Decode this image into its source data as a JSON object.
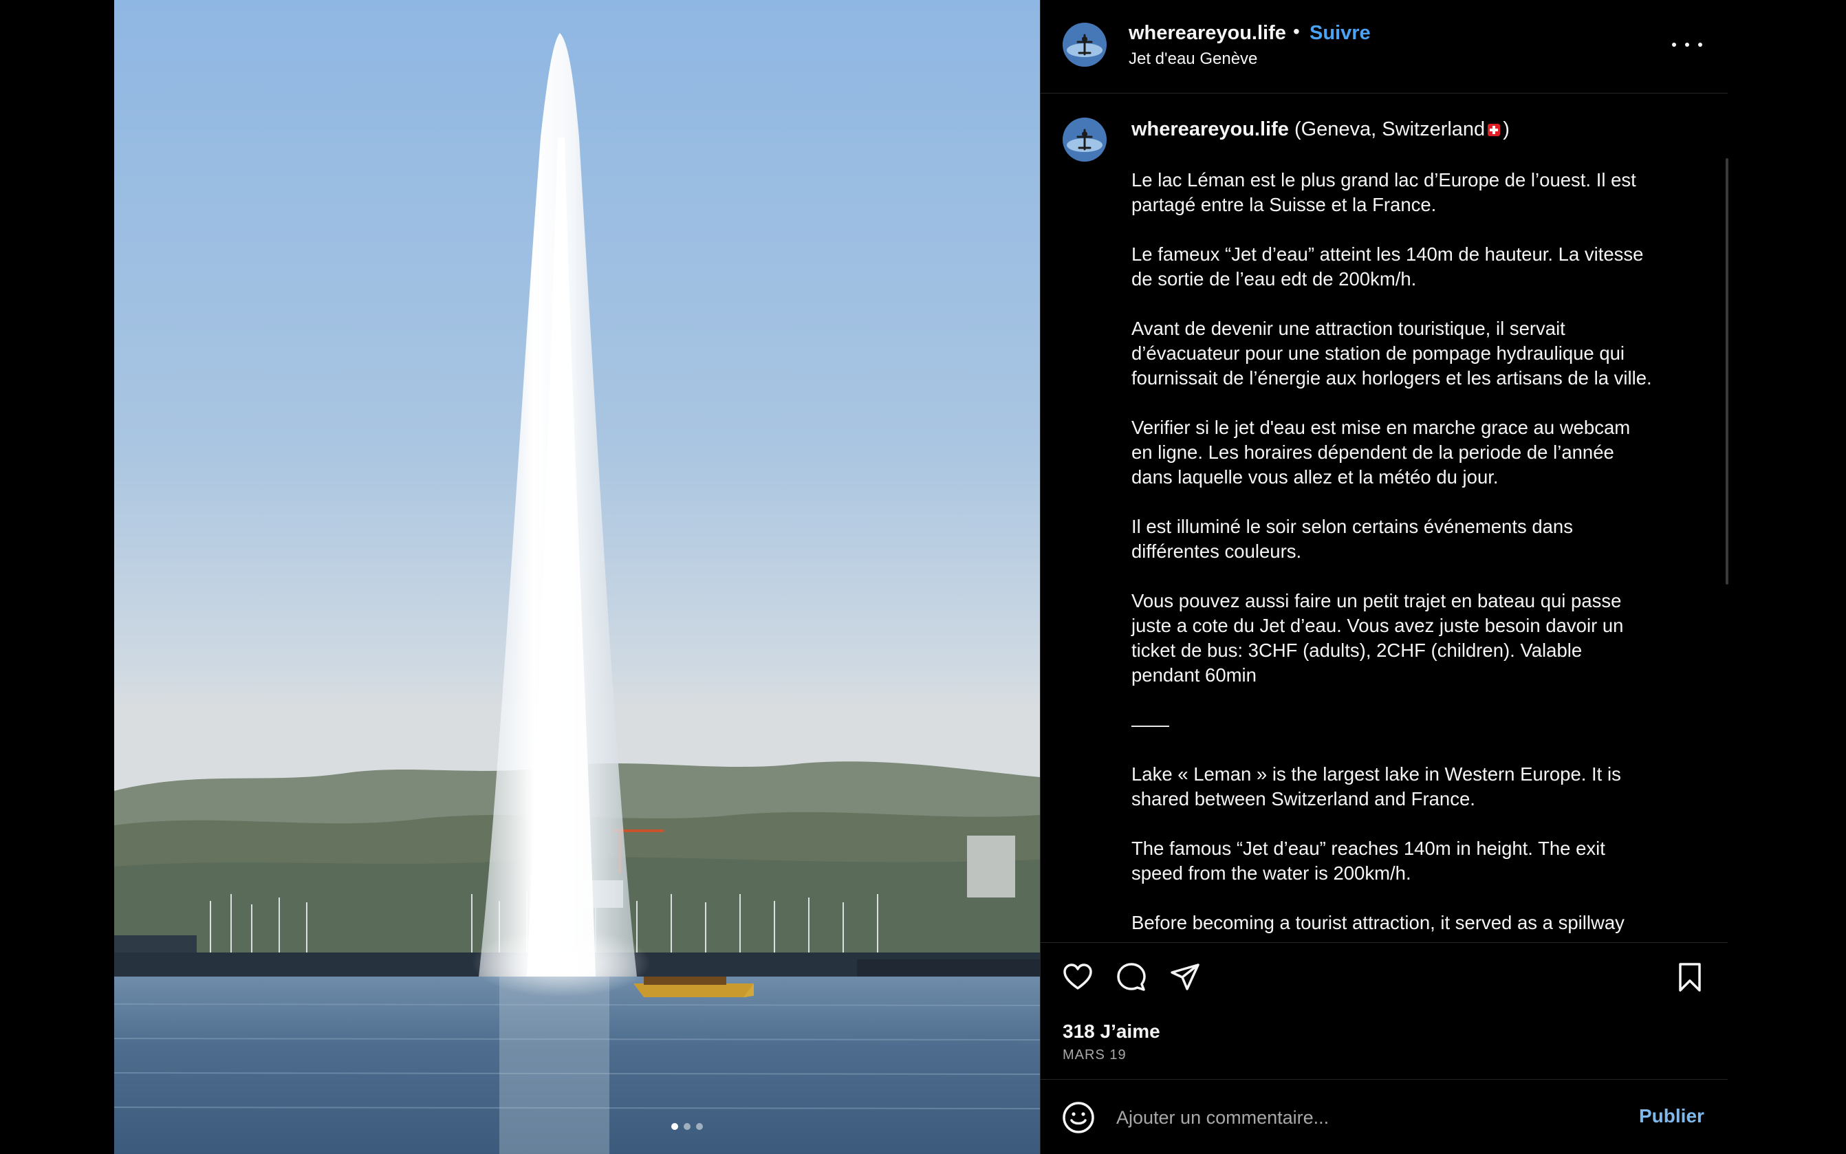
{
  "header": {
    "username": "whereareyou.life",
    "separator": "•",
    "follow_label": "Suivre",
    "location": "Jet d'eau Genève"
  },
  "caption": {
    "username": "whereareyou.life",
    "location_open": "(Geneva, Switzerland",
    "location_close": ")",
    "paragraphs": [
      "Le lac Léman est le plus grand lac d’Europe de l’ouest. Il est\npartagé entre la Suisse et la France.",
      "Le fameux “Jet d’eau” atteint les 140m de hauteur. La vitesse\nde sortie de l’eau edt de 200km/h.",
      "Avant de devenir une attraction touristique, il servait\nd’évacuateur pour une station de pompage hydraulique qui\nfournissait de l’énergie aux horlogers et les artisans de la ville.",
      "Verifier si le jet d'eau est mise en marche grace au webcam\nen ligne. Les horaires dépendent de la periode de l’année\ndans laquelle vous allez et la météo du jour.",
      "Il est illuminé le soir selon certains événements dans\ndifférentes couleurs.",
      "Vous pouvez aussi faire un petit trajet en bateau qui passe\njuste a cote du Jet d’eau. Vous avez juste besoin davoir un\nticket de bus: 3CHF (adults), 2CHF (children). Valable\npendant 60min",
      "——",
      "Lake « Leman » is the largest lake in Western Europe. It is\nshared between Switzerland and France.",
      "The famous “Jet d’eau” reaches 140m in height. The exit\nspeed from the water is 200km/h.",
      "Before becoming a tourist attraction, it served as a spillway"
    ]
  },
  "stats": {
    "likes": "318 J’aime",
    "date": "MARS 19"
  },
  "comment": {
    "placeholder": "Ajouter un commentaire...",
    "publish_label": "Publier"
  },
  "carousel": {
    "slide_count": 3,
    "active_slide": 1
  },
  "icons": {
    "like": "heart-icon",
    "comment": "comment-bubble-icon",
    "share": "paper-plane-icon",
    "save": "bookmark-icon",
    "more": "more-dots-icon",
    "next": "chevron-right-icon",
    "emoji": "smiley-icon"
  },
  "colors": {
    "background": "#000000",
    "follow": "#4aa3f5",
    "publish": "#7fb8ea",
    "muted_text": "#a8a8a8",
    "divider": "#262626"
  }
}
